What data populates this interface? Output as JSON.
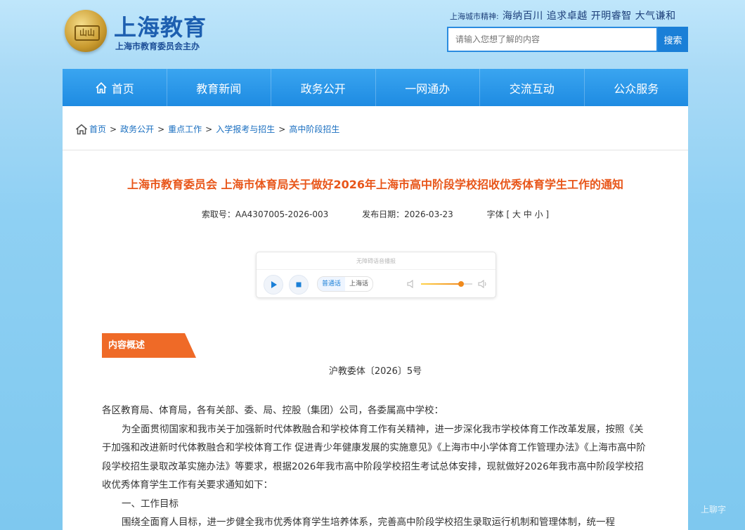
{
  "header": {
    "logo_emblem_text": "山山",
    "logo_title": "上海教育",
    "logo_subtitle": "上海市教育委员会主办",
    "spirit_label": "上海城市精神:",
    "spirit_text": "海纳百川 追求卓越 开明睿智 大气谦和",
    "search_placeholder": "请输入您想了解的内容",
    "search_button": "搜索"
  },
  "nav": {
    "items": [
      "首页",
      "教育新闻",
      "政务公开",
      "一网通办",
      "交流互动",
      "公众服务"
    ]
  },
  "breadcrumb": {
    "items": [
      "首页",
      "政务公开",
      "重点工作",
      "入学报考与招生",
      "高中阶段招生"
    ],
    "separator": ">"
  },
  "article": {
    "title": "上海市教育委员会 上海市体育局关于做好2026年上海市高中阶段学校招收优秀体育学生工作的通知",
    "index_no": "索取号：AA4307005-2026-003",
    "publish_date": "发布日期：2026-03-23",
    "font_size": "字体 [ 大 中 小 ]",
    "section_tag": "内容概述",
    "doc_number": "沪教委体〔2026〕5号",
    "paragraphs": [
      "各区教育局、体育局，各有关部、委、局、控股（集团）公司，各委属高中学校：",
      "为全面贯彻国家和我市关于加强新时代体教融合和学校体育工作有关精神，进一步深化我市学校体育工作改革发展，按照《关于加强和改进新时代体教融合和学校体育工作 促进青少年健康发展的实施意见》《上海市中小学体育工作管理办法》《上海市高中阶段学校招生录取改革实施办法》等要求，根据2026年我市高中阶段学校招生考试总体安排，现就做好2026年我市高中阶段学校招收优秀体育学生工作有关要求通知如下：",
      "一、工作目标",
      "围绕全面育人目标，进一步健全我市优秀体育学生培养体系，完善高中阶段学校招生录取运行机制和管理体制，统一程"
    ]
  },
  "player": {
    "caption": "无障碍语音播报",
    "lang_options": [
      "普通话",
      "上海话"
    ],
    "selected_lang": "普通话",
    "volume_fraction": 0.78
  },
  "watermark": "上聊字",
  "colors": {
    "nav_blue": "#1e8be2",
    "title_orange": "#e8561a",
    "tag_orange": "#ef6a27",
    "link_blue": "#1a6fc0"
  }
}
